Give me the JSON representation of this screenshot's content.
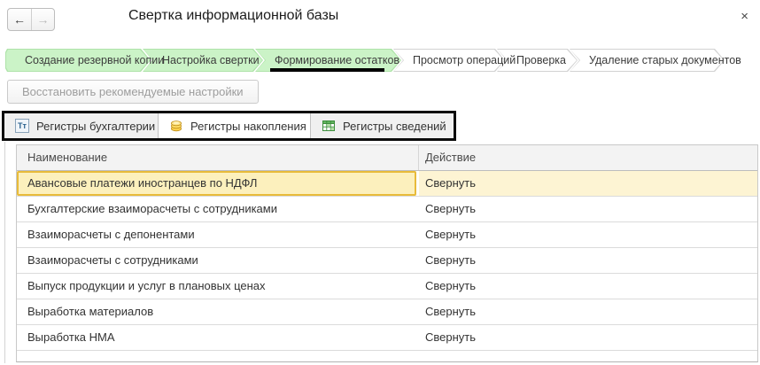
{
  "header": {
    "title": "Свертка информационной базы"
  },
  "icons": {
    "back_arrow": "←",
    "forward_arrow": "→",
    "close": "×",
    "accounting_register_glyph": "Тт"
  },
  "wizard": {
    "steps": [
      {
        "label": "Создание резервной копии",
        "state": "completed"
      },
      {
        "label": "Настройка свертки",
        "state": "completed"
      },
      {
        "label": "Формирование остатков",
        "state": "current"
      },
      {
        "label": "Просмотр операций",
        "state": "upcoming"
      },
      {
        "label": "Проверка",
        "state": "upcoming"
      },
      {
        "label": "Удаление старых документов",
        "state": "upcoming"
      }
    ]
  },
  "toolbar": {
    "restore_button_label": "Восстановить рекомендуемые настройки",
    "restore_button_enabled": false
  },
  "register_tabs": [
    {
      "label": "Регистры бухгалтерии",
      "icon": "accounting-register-icon",
      "active": false
    },
    {
      "label": "Регистры накопления",
      "icon": "accumulation-register-icon",
      "active": true
    },
    {
      "label": "Регистры сведений",
      "icon": "information-register-icon",
      "active": false
    }
  ],
  "registers_table": {
    "columns": {
      "name": "Наименование",
      "action": "Действие"
    },
    "rows": [
      {
        "name": "Авансовые платежи иностранцев по НДФЛ",
        "action": "Свернуть",
        "selected": true
      },
      {
        "name": "Бухгалтерские взаиморасчеты с сотрудниками",
        "action": "Свернуть",
        "selected": false
      },
      {
        "name": "Взаиморасчеты с депонентами",
        "action": "Свернуть",
        "selected": false
      },
      {
        "name": "Взаиморасчеты с сотрудниками",
        "action": "Свернуть",
        "selected": false
      },
      {
        "name": "Выпуск продукции и услуг в плановых ценах",
        "action": "Свернуть",
        "selected": false
      },
      {
        "name": "Выработка материалов",
        "action": "Свернуть",
        "selected": false
      },
      {
        "name": "Выработка НМА",
        "action": "Свернуть",
        "selected": false
      }
    ]
  },
  "colors": {
    "step_completed_bg": "#cbf3c7",
    "selected_row_bg": "#fcf0bd",
    "selected_cell_border": "#e8bb3a",
    "annotation_box": "#000000"
  }
}
